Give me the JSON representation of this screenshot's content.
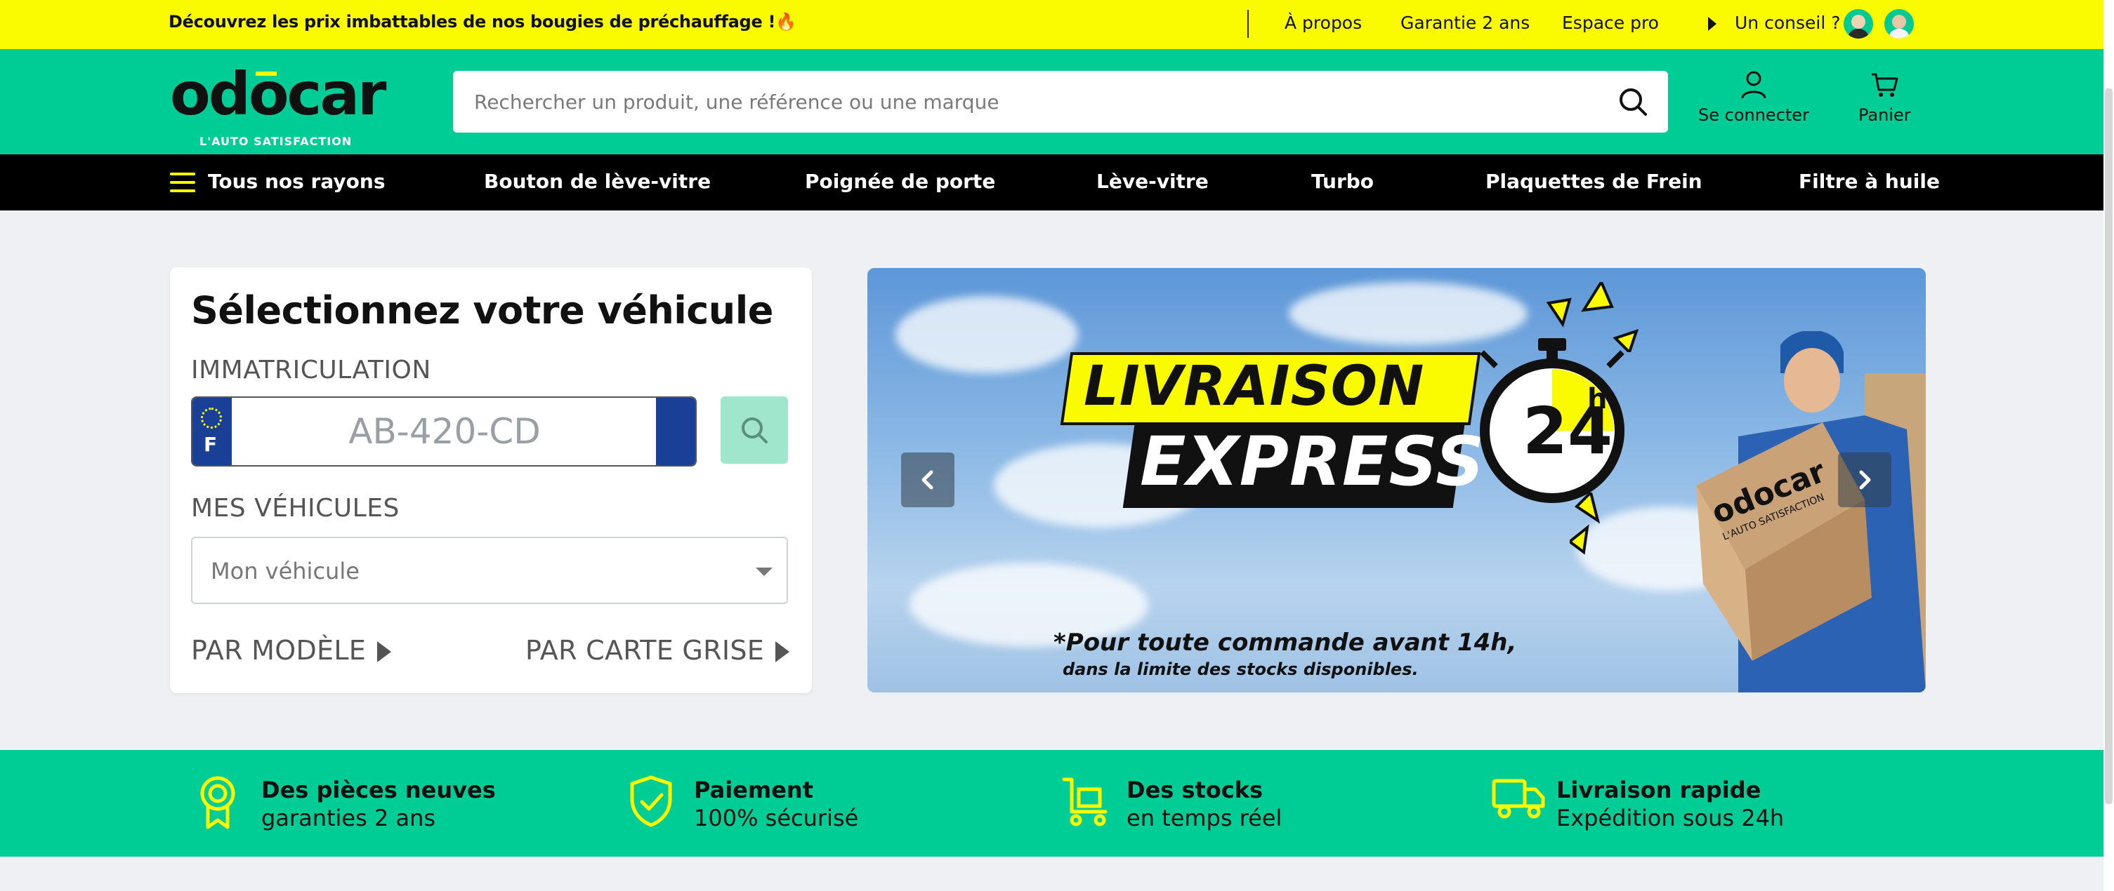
{
  "topbar": {
    "promo": "Découvrez les prix imbattables de nos bougies de préchauffage !🔥",
    "links": [
      "À propos",
      "Garantie 2 ans",
      "Espace pro"
    ],
    "advice": "Un conseil ?"
  },
  "header": {
    "logo": "odocar",
    "logo_tagline": "L'AUTO SATISFACTION",
    "search_placeholder": "Rechercher un produit, une référence ou une marque",
    "login_label": "Se connecter",
    "cart_label": "Panier"
  },
  "nav": {
    "all_label": "Tous nos rayons",
    "items": [
      "Bouton de lève-vitre",
      "Poignée de porte",
      "Lève-vitre",
      "Turbo",
      "Plaquettes de Frein",
      "Filtre à huile"
    ]
  },
  "vehicle": {
    "title": "Sélectionnez votre véhicule",
    "plate_label": "IMMATRICULATION",
    "plate_country": "F",
    "plate_placeholder": "AB-420-CD",
    "my_vehicles_label": "MES VÉHICULES",
    "my_vehicle_value": "Mon véhicule",
    "by_model": "PAR MODÈLE",
    "by_card": "PAR CARTE GRISE"
  },
  "banner": {
    "line1": "LIVRAISON",
    "line2": "EXPRESS*",
    "badge": "24",
    "badge_unit": "h",
    "box_logo": "odocar",
    "box_tagline": "L'AUTO SATISFACTION",
    "note1": "*Pour toute commande avant 14h,",
    "note2": "dans la limite des stocks disponibles."
  },
  "features": [
    {
      "title": "Des pièces neuves",
      "subtitle": "garanties 2 ans",
      "icon": "award-icon"
    },
    {
      "title": "Paiement",
      "subtitle": "100% sécurisé",
      "icon": "shield-check-icon"
    },
    {
      "title": "Des stocks",
      "subtitle": "en temps réel",
      "icon": "cart-stock-icon"
    },
    {
      "title": "Livraison rapide",
      "subtitle": "Expédition sous 24h",
      "icon": "truck-icon"
    }
  ],
  "colors": {
    "brand_green": "#00cc95",
    "brand_yellow": "#fbfb00",
    "nav_black": "#000000",
    "plate_blue": "#1a3f96"
  }
}
